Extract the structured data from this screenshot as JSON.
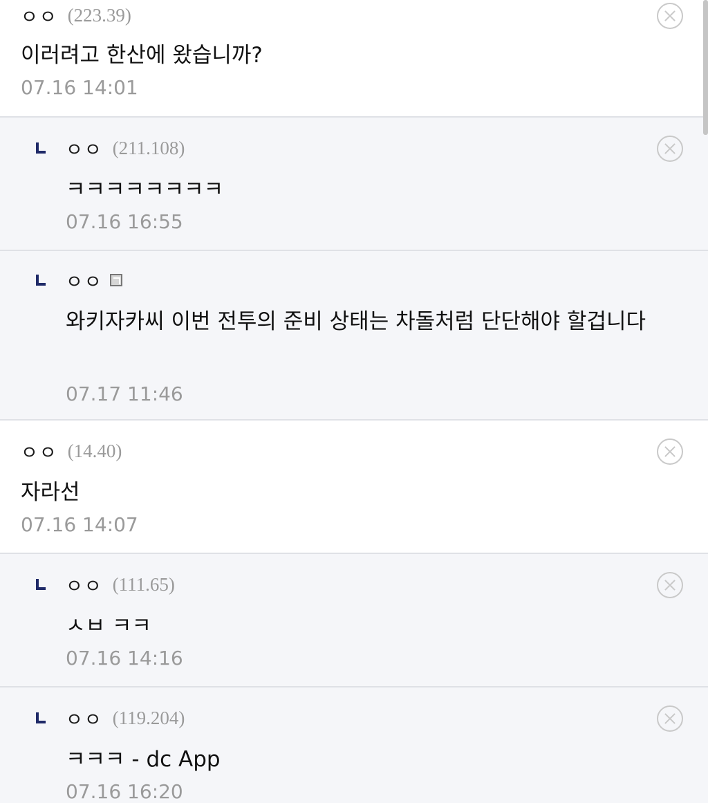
{
  "comments": [
    {
      "type": "top",
      "nickname": "ㅇㅇ",
      "ip": "(223.39)",
      "text": "이러려고 한산에 왔습니까?",
      "time": "07.16 14:01"
    },
    {
      "type": "reply",
      "nickname": "ㅇㅇ",
      "ip": "(211.108)",
      "text": "ㅋㅋㅋㅋㅋㅋㅋㅋ",
      "time": "07.16 16:55"
    },
    {
      "type": "reply",
      "nickname": "ㅇㅇ",
      "ip": "",
      "member_icon": "fixed-nick-icon",
      "text": "와키자카씨 이번 전투의 준비 상태는 차돌처럼 단단해야 할겁니다",
      "time": "07.17 11:46"
    },
    {
      "type": "top",
      "nickname": "ㅇㅇ",
      "ip": "(14.40)",
      "text": "자라선",
      "time": "07.16 14:07"
    },
    {
      "type": "reply",
      "nickname": "ㅇㅇ",
      "ip": "(111.65)",
      "text": "ㅅㅂ ㅋㅋ",
      "time": "07.16 14:16"
    },
    {
      "type": "reply",
      "nickname": "ㅇㅇ",
      "ip": "(119.204)",
      "text": "ㅋㅋㅋ - dc App",
      "time": "07.16 16:20"
    }
  ],
  "icons": {
    "delete": "close-circle-icon",
    "reply": "reply-arrow-icon"
  },
  "colors": {
    "reply_background": "#f5f6f9",
    "reply_marker": "#1f2a68",
    "meta_gray": "#9a9a9a"
  }
}
